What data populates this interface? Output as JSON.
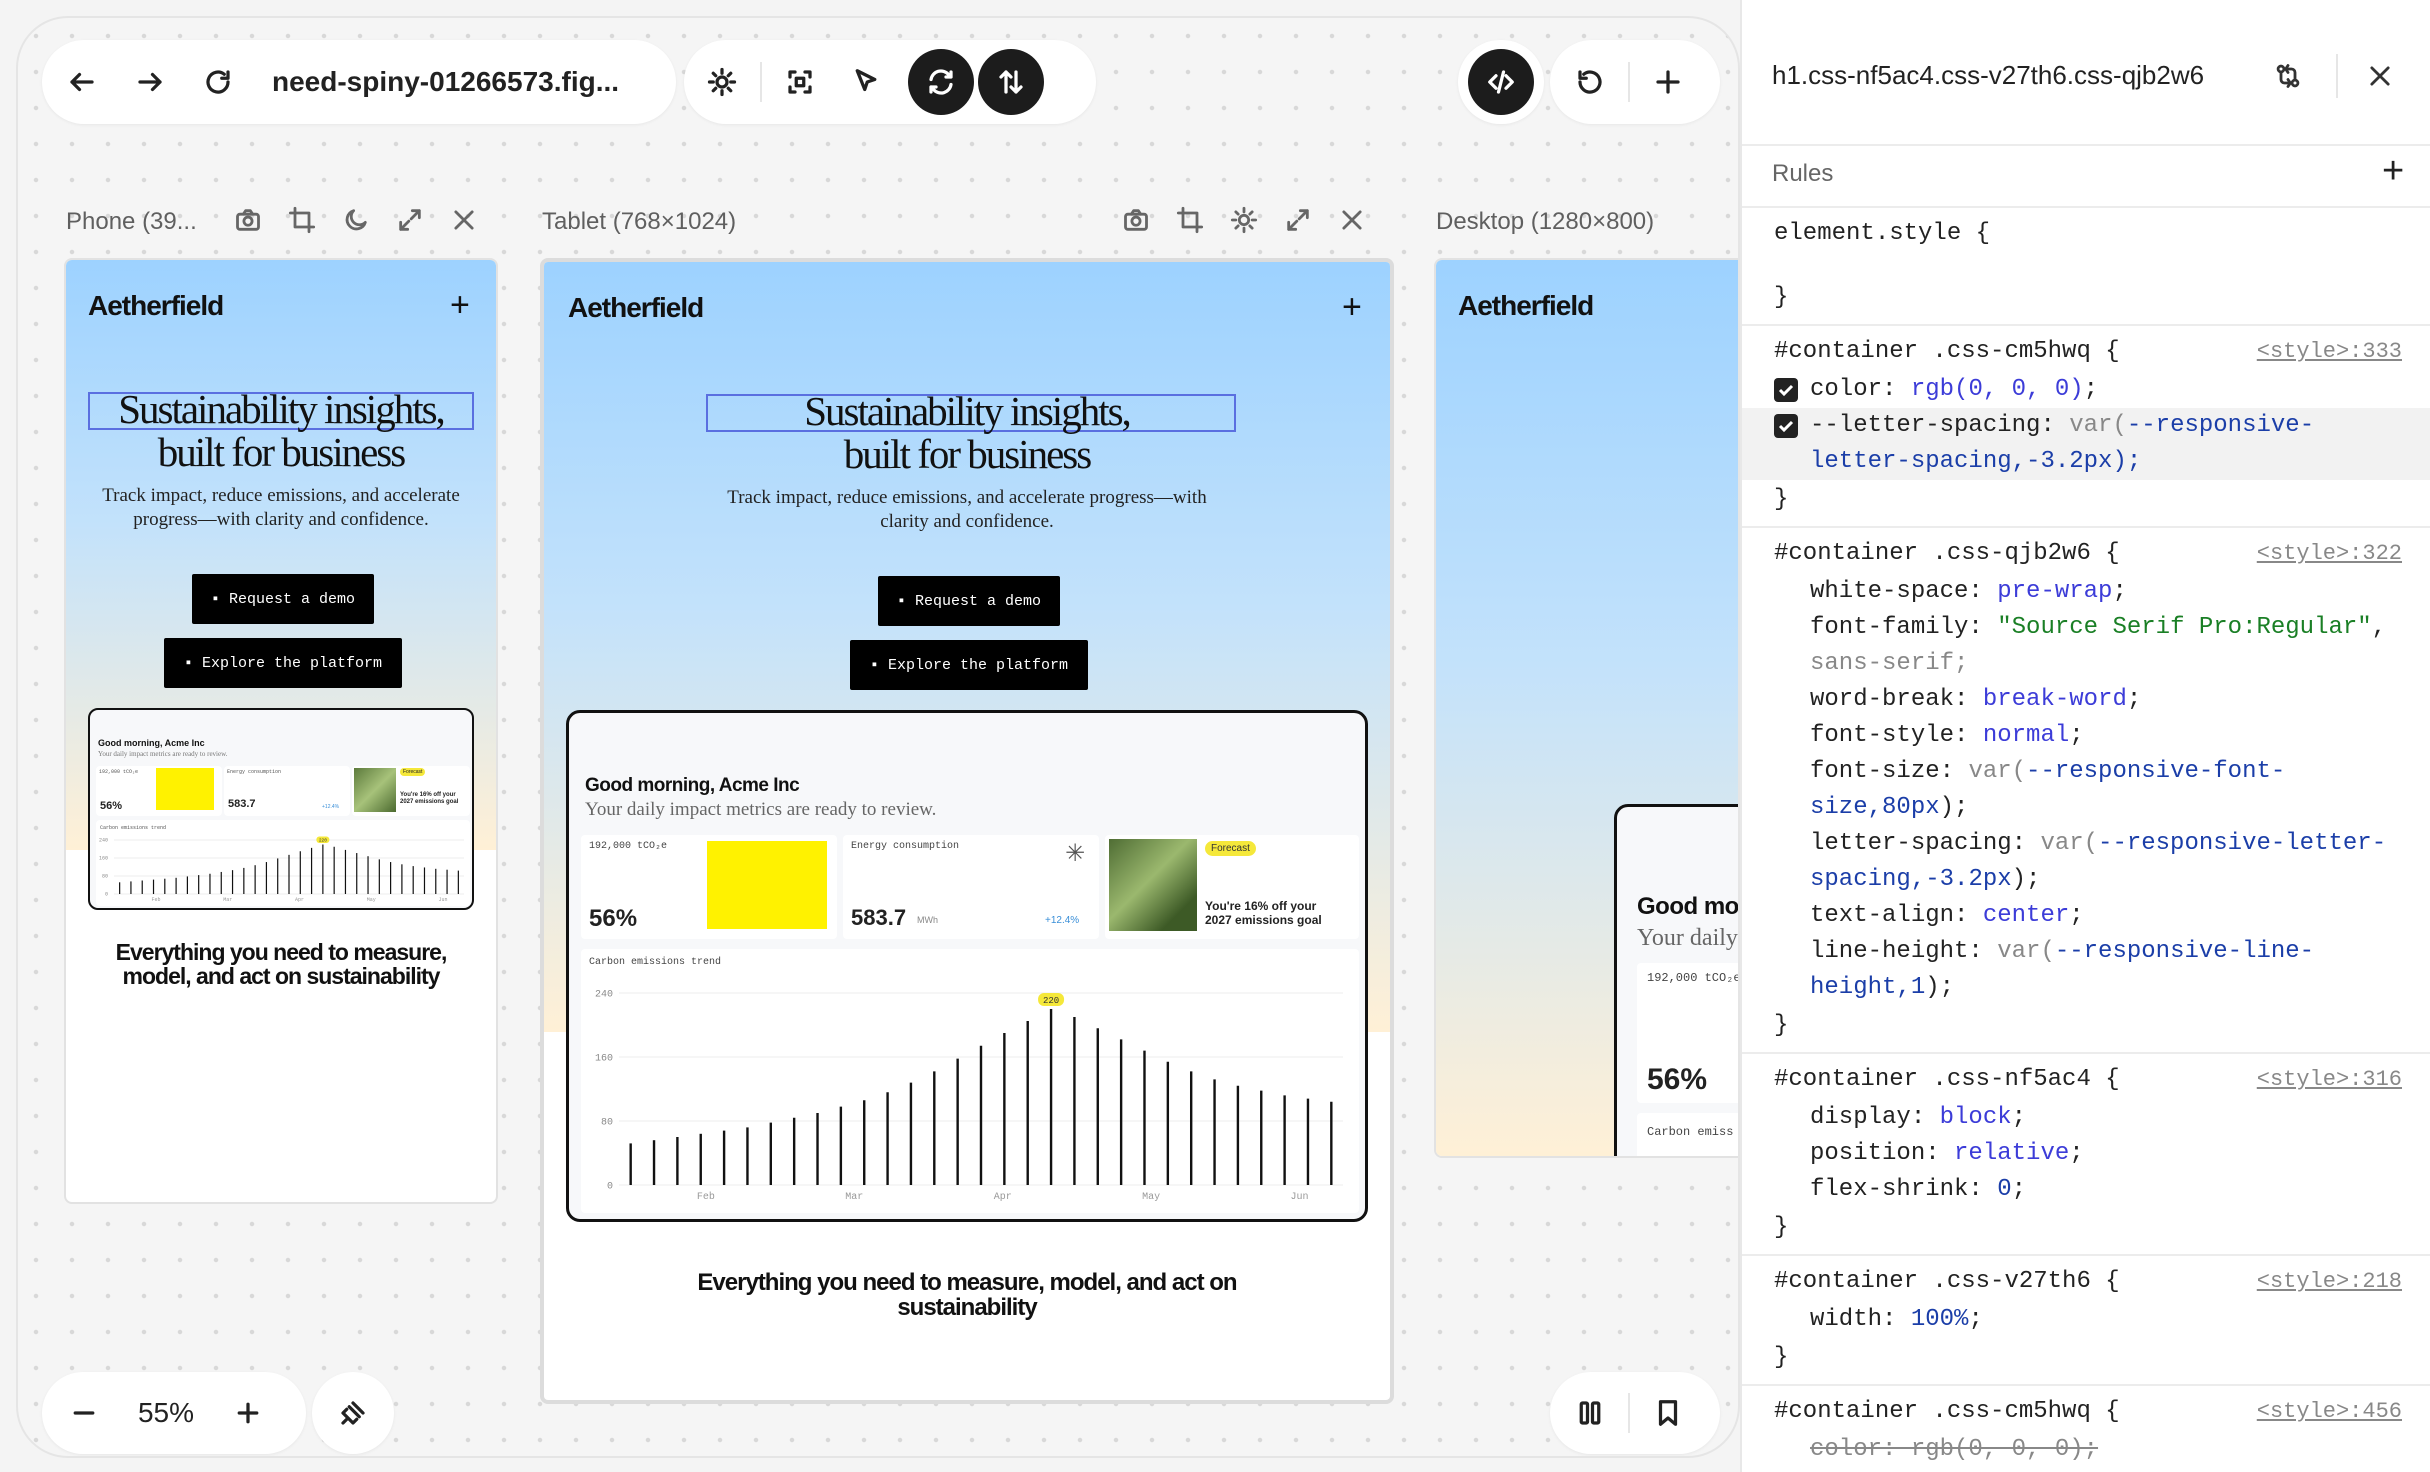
{
  "toolbar": {
    "filename": "need-spiny-01266573.fig..."
  },
  "zoom": {
    "value": "55%"
  },
  "frames": {
    "phone": {
      "title": "Phone (39..."
    },
    "tablet": {
      "title": "Tablet (768×1024)"
    },
    "desktop": {
      "title": "Desktop (1280×800)"
    }
  },
  "site": {
    "brand": "Aetherfield",
    "headline_1": "Sustainability insights,",
    "headline_2": "built for business",
    "sub_phone_1": "Track impact, reduce emissions, and accelerate",
    "sub_phone_2": "progress—with clarity and confidence.",
    "sub_tablet_1": "Track impact, reduce emissions, and accelerate progress—with",
    "sub_tablet_2": "clarity and confidence.",
    "btn_demo": "▪ Request a demo",
    "btn_explore": "▪ Explore the platform",
    "bottom_phone_1": "Everything you need to measure,",
    "bottom_phone_2": "model, and act on sustainability",
    "bottom_tablet_1": "Everything you need to measure, model, and act on",
    "bottom_tablet_2": "sustainability"
  },
  "dashboard": {
    "greeting": "Good morning, Acme Inc",
    "greeting_short": "Good mor",
    "subline": "Your daily impact metrics are ready to review.",
    "subline_short": "Your daily",
    "metric1_label": "192,000 tCO₂e",
    "metric1_value": "56%",
    "metric2_label": "Energy consumption",
    "metric2_value": "583.7",
    "metric2_unit": "MWh",
    "metric2_delta": "+12.4%",
    "forecast_tag": "Forecast",
    "forecast_text_1": "You're 16% off your",
    "forecast_text_2": "2027 emissions goal",
    "chart_title": "Carbon emissions trend",
    "chart_title_short": "Carbon emiss",
    "peak_label": "220",
    "y_ticks": [
      "240",
      "160",
      "80",
      "0"
    ],
    "x_ticks": [
      "Feb",
      "Mar",
      "Apr",
      "May",
      "Jun"
    ]
  },
  "chart_data": {
    "type": "bar",
    "title": "Carbon emissions trend",
    "xlabel": "",
    "ylabel": "",
    "ylim": [
      0,
      240
    ],
    "y_ticks": [
      0,
      80,
      160,
      240
    ],
    "x_ticks": [
      "Feb",
      "Mar",
      "Apr",
      "May",
      "Jun"
    ],
    "values": [
      52,
      56,
      60,
      64,
      68,
      72,
      78,
      84,
      90,
      98,
      106,
      116,
      128,
      142,
      158,
      174,
      190,
      205,
      220,
      210,
      196,
      182,
      168,
      154,
      142,
      132,
      124,
      118,
      112,
      108,
      104
    ]
  },
  "panel": {
    "selector": "h1.css-nf5ac4.css-v27th6.css-qjb2w6",
    "rules_label": "Rules"
  },
  "css": {
    "r0_sel": "element.style {",
    "close": "}",
    "r1_sel": "#container .css-cm5hwq {",
    "r1_src": "<style>:333",
    "r1_p1": "color: ",
    "r1_v1": "rgb(0, 0, 0)",
    "r1_p2": "--letter-spacing: ",
    "r1_v2a": "var(",
    "r1_v2b": "--responsive-",
    "r1_v2c": "letter-spacing",
    "r1_v2d": ",-3.2px);",
    "r2_sel": "#container .css-qjb2w6 {",
    "r2_src": "<style>:322",
    "r2_l1p": "white-space: ",
    "r2_l1v": "pre-wrap",
    "r2_l2p": "font-family: ",
    "r2_l2v": "\"Source Serif Pro:Regular\"",
    "r2_l3v": "sans-serif",
    "r2_l4p": "word-break: ",
    "r2_l4v": "break-word",
    "r2_l5p": "font-style: ",
    "r2_l5v": "normal",
    "r2_l6p": "font-size: ",
    "r2_l6a": "var(",
    "r2_l6b": "--responsive-font-",
    "r2_l7a": "size",
    "r2_l7b": ",80px",
    "r2_l8p": "letter-spacing: ",
    "r2_l8a": "var(",
    "r2_l8b": "--responsive-letter-",
    "r2_l9a": "spacing",
    "r2_l9b": ",-3.2px",
    "r2_l10p": "text-align: ",
    "r2_l10v": "center",
    "r2_l11p": "line-height: ",
    "r2_l11a": "var(",
    "r2_l11b": "--responsive-line-",
    "r2_l12a": "height",
    "r2_l12b": ",1",
    "r3_sel": "#container .css-nf5ac4 {",
    "r3_src": "<style>:316",
    "r3_l1p": "display: ",
    "r3_l1v": "block",
    "r3_l2p": "position: ",
    "r3_l2v": "relative",
    "r3_l3p": "flex-shrink: ",
    "r3_l3v": "0",
    "r4_sel": "#container .css-v27th6 {",
    "r4_src": "<style>:218",
    "r4_l1p": "width: ",
    "r4_l1v": "100%",
    "r5_sel": "#container .css-cm5hwq {",
    "r5_src": "<style>:456",
    "r5_l1": "color: rgb(0, 0, 0);"
  }
}
